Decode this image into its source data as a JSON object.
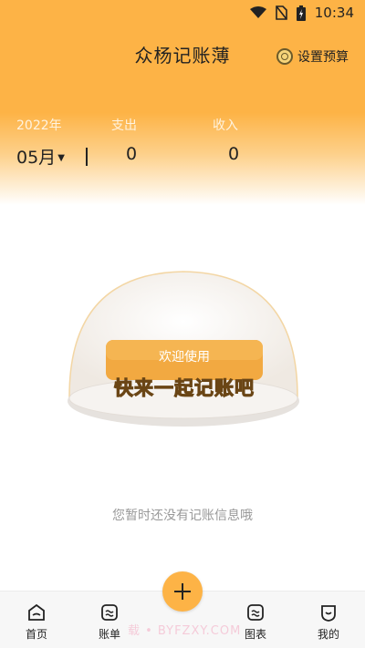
{
  "status": {
    "time": "10:34"
  },
  "header": {
    "title": "众杨记账薄",
    "budget_label": "设置预算"
  },
  "summary": {
    "year": "2022年",
    "month": "05月",
    "expense_label": "支出",
    "income_label": "收入",
    "expense_value": "0",
    "income_value": "0"
  },
  "empty": {
    "welcome": "欢迎使用",
    "slogan": "快来一起记账吧",
    "message": "您暂时还没有记账信息哦"
  },
  "tabs": [
    {
      "label": "首页",
      "icon": "home-icon"
    },
    {
      "label": "账单",
      "icon": "bill-icon"
    },
    {
      "label": "图表",
      "icon": "chart-icon"
    },
    {
      "label": "我的",
      "icon": "profile-icon"
    }
  ],
  "watermark": "载 • BYFZXY.COM",
  "colors": {
    "accent": "#fdb346"
  }
}
